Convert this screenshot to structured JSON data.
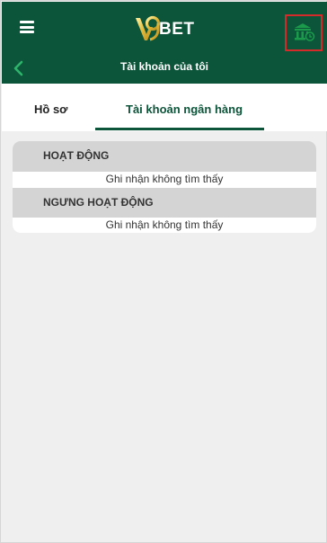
{
  "header": {
    "brand_text": "BET",
    "logo_letter": "V9",
    "menu_icon": "hamburger-icon",
    "bank_icon": "bank-icon",
    "accent_color": "#0c553a",
    "highlight_color": "#d62a2a"
  },
  "subheader": {
    "title": "Tài khoản của tôi",
    "back_icon": "chevron-left-icon"
  },
  "tabs": [
    {
      "label": "Hồ sơ",
      "active": false
    },
    {
      "label": "Tài khoản ngân hàng",
      "active": true
    }
  ],
  "sections": {
    "active": {
      "title": "HOẠT ĐỘNG",
      "empty_text": "Ghi nhận không tìm thấy"
    },
    "inactive": {
      "title": "NGƯNG HOẠT ĐỘNG",
      "empty_text": "Ghi nhận không tìm thấy"
    }
  }
}
